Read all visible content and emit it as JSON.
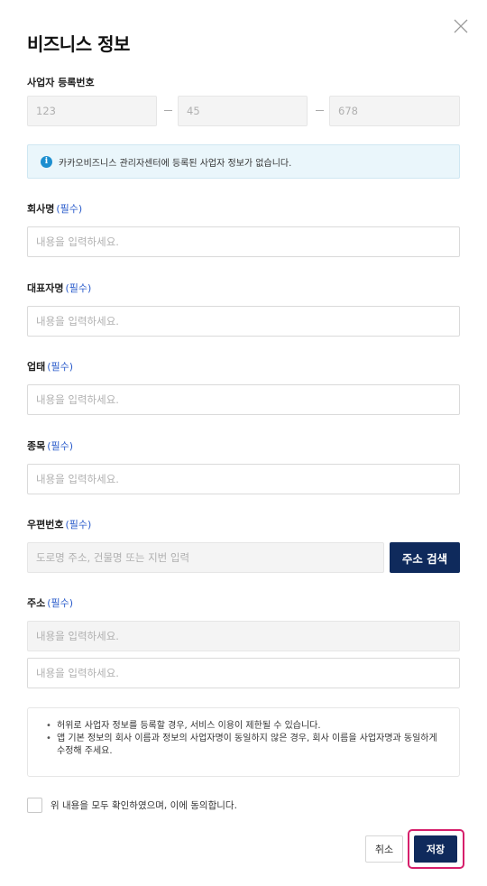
{
  "dialog": {
    "title": "비즈니스 정보",
    "close_icon": "close-icon"
  },
  "business_number": {
    "label": "사업자 등록번호",
    "part1": "123",
    "part2": "45",
    "part3": "678"
  },
  "notice": {
    "icon": "info-icon",
    "icon_char": "i",
    "text": "카카오비즈니스 관리자센터에 등록된 사업자 정보가 없습니다."
  },
  "fields": {
    "required_tag": "(필수)",
    "company_name": {
      "label": "회사명",
      "placeholder": "내용을 입력하세요."
    },
    "ceo_name": {
      "label": "대표자명",
      "placeholder": "내용을 입력하세요."
    },
    "business_type": {
      "label": "업태",
      "placeholder": "내용을 입력하세요."
    },
    "business_item": {
      "label": "종목",
      "placeholder": "내용을 입력하세요."
    },
    "postal_code": {
      "label": "우편번호",
      "placeholder": "도로명 주소, 건물명 또는 지번 입력",
      "search_label": "주소 검색"
    },
    "address": {
      "label": "주소",
      "line1_placeholder": "내용을 입력하세요.",
      "line2_placeholder": "내용을 입력하세요."
    }
  },
  "warnings": [
    "허위로 사업자 정보를 등록할 경우, 서비스 이용이 제한될 수 있습니다.",
    "앱 기본 정보의 회사 이름과 정보의 사업자명이 동일하지 않은 경우, 회사 이름을 사업자명과 동일하게 수정해 주세요."
  ],
  "agreement": {
    "label": "위 내용을 모두 확인하였으며, 이에 동의합니다."
  },
  "actions": {
    "cancel_label": "취소",
    "save_label": "저장"
  },
  "colors": {
    "primary_navy": "#0f2a5c",
    "required_blue": "#2b5ccb",
    "info_blue": "#1d8fd0",
    "highlight_pink": "#d61f6b"
  }
}
